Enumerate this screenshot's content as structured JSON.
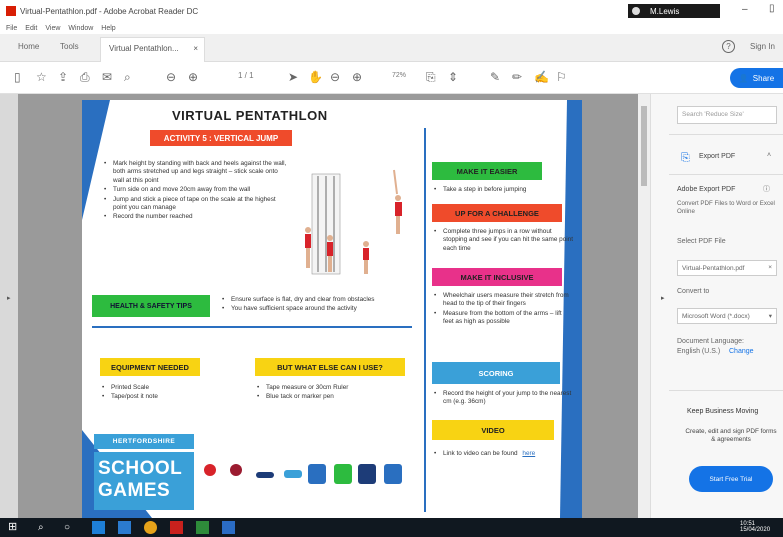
{
  "window": {
    "title": "Virtual-Pentathlon.pdf - Adobe Acrobat Reader DC",
    "user": "M.Lewis",
    "menu": [
      "File",
      "Edit",
      "View",
      "Window",
      "Help"
    ]
  },
  "tabs": {
    "home": "Home",
    "tools": "Tools",
    "document": "Virtual Pentathlon...",
    "close": "×",
    "help": "?",
    "signin": "Sign In"
  },
  "toolbar": {
    "page_indicator": "1 / 1",
    "zoom": "72%",
    "share_label": "Share"
  },
  "document": {
    "title": "VIRTUAL PENTATHLON",
    "activity": "ACTIVITY 5 : VERTICAL JUMP",
    "steps": [
      "Mark height by standing with back and heels against the wall, both arms stretched up and legs straight – stick scale onto wall at this point",
      "Turn side on and move 20cm away from the wall",
      "Jump and stick a piece of tape on the scale at the highest point you can manage",
      "Record the number reached"
    ],
    "health_safety": {
      "label": "HEALTH & SAFETY TIPS",
      "items": [
        "Ensure surface is flat, dry and clear from obstacles",
        "You have sufficient space around the activity"
      ]
    },
    "equipment": {
      "label": "EQUIPMENT NEEDED",
      "items": [
        "Printed Scale",
        "Tape/post it note"
      ]
    },
    "what_else": {
      "label": "BUT WHAT ELSE CAN I USE?",
      "items": [
        "Tape measure or 30cm Ruler",
        "Blue tack or marker pen"
      ]
    },
    "herts_label": "HERTFORDSHIRE",
    "school_games_1": "SCHOOL",
    "school_games_2": "GAMES",
    "make_it_easier": {
      "label": "MAKE IT EASIER",
      "items": [
        "Take a step in before jumping"
      ]
    },
    "challenge": {
      "label": "UP FOR A CHALLENGE",
      "items": [
        "Complete three jumps in a row without stopping and see if you can hit the same point each time"
      ]
    },
    "inclusive": {
      "label": "MAKE IT INCLUSIVE",
      "items": [
        "Wheelchair users measure their stretch from head to the tip of their fingers",
        "Measure from the bottom of the arms – lift feet as high as possible"
      ]
    },
    "scoring": {
      "label": "SCORING",
      "items": [
        "Record the height of your jump to the nearest cm (e.g. 36cm)"
      ]
    },
    "video": {
      "label": "VIDEO",
      "items": [
        "Link to video can be found"
      ],
      "link": "here"
    }
  },
  "right_pane": {
    "search_placeholder": "Search 'Reduce Size'",
    "export_pdf": "Export PDF",
    "adobe_export_title": "Adobe Export PDF",
    "adobe_export_desc": "Convert PDF Files to Word or Excel Online",
    "select_file": "Select PDF File",
    "file_name": "Virtual-Pentathlon.pdf",
    "convert_to": "Convert to",
    "format": "Microsoft Word (*.docx)",
    "doc_language_label": "Document Language:",
    "doc_language": "English (U.S.)",
    "change": "Change",
    "promo_title": "Keep Business Moving",
    "promo_desc": "Create, edit and sign PDF forms & agreements",
    "cta": "Start Free Trial"
  },
  "taskbar": {
    "time": "10:51",
    "date": "15/04/2020"
  },
  "colors": {
    "accent": "#1473e6",
    "activity_red": "#ef4b2b",
    "health_green": "#2dbb3f",
    "yellow": "#f8d313",
    "magenta": "#e8318a",
    "sky_blue": "#3aa0d8",
    "doc_blue": "#2a6fc0"
  }
}
